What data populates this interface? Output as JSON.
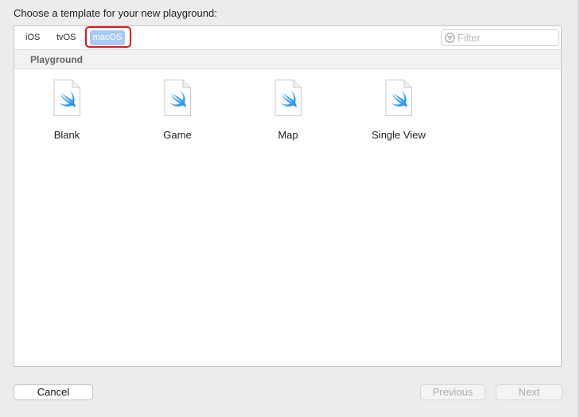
{
  "dialog": {
    "prompt": "Choose a template for your new playground:"
  },
  "platforms": {
    "tabs": [
      {
        "label": "iOS",
        "selected": false
      },
      {
        "label": "tvOS",
        "selected": false
      },
      {
        "label": "macOS",
        "selected": true
      }
    ]
  },
  "filter": {
    "placeholder": "Filter",
    "value": ""
  },
  "section": {
    "title": "Playground"
  },
  "templates": [
    {
      "label": "Blank",
      "icon": "swift-file-icon"
    },
    {
      "label": "Game",
      "icon": "swift-file-icon"
    },
    {
      "label": "Map",
      "icon": "swift-file-icon"
    },
    {
      "label": "Single View",
      "icon": "swift-file-icon"
    }
  ],
  "buttons": {
    "cancel": "Cancel",
    "previous": "Previous",
    "next": "Next"
  },
  "colors": {
    "selected_tab": "#a7cbf7",
    "highlight_box": "#e3161c",
    "swift_gradient_start": "#6bbdf9",
    "swift_gradient_end": "#1e8ef5"
  }
}
